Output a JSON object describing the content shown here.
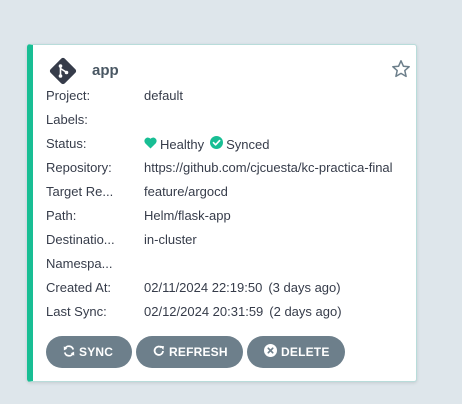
{
  "app": {
    "name": "app",
    "logo_icon": "git-icon",
    "favorite_icon": "star-outline-icon"
  },
  "fields": {
    "project": {
      "label": "Project:",
      "value": "default"
    },
    "labels": {
      "label": "Labels:",
      "value": ""
    },
    "status": {
      "label": "Status:",
      "health": "Healthy",
      "health_icon": "heart-icon",
      "health_color": "#18be94",
      "sync": "Synced",
      "sync_icon": "check-circle-icon",
      "sync_color": "#18be94"
    },
    "repository": {
      "label": "Repository:",
      "value": "https://github.com/cjcuesta/kc-practica-final"
    },
    "target_revision": {
      "label": "Target Re...",
      "value": "feature/argocd"
    },
    "path": {
      "label": "Path:",
      "value": "Helm/flask-app"
    },
    "destination": {
      "label": "Destinatio...",
      "value": "in-cluster"
    },
    "namespace": {
      "label": "Namespa...",
      "value": ""
    },
    "created_at": {
      "label": "Created At:",
      "value": "02/11/2024 22:19:50",
      "ago": "(3 days ago)"
    },
    "last_sync": {
      "label": "Last Sync:",
      "value": "02/12/2024 20:31:59",
      "ago": "(2 days ago)"
    }
  },
  "actions": {
    "sync": {
      "label": "SYNC",
      "icon": "sync-icon"
    },
    "refresh": {
      "label": "REFRESH",
      "icon": "refresh-icon"
    },
    "delete": {
      "label": "DELETE",
      "icon": "times-circle-icon"
    }
  },
  "colors": {
    "accent": "#18be94",
    "button_bg": "#6d7f8b",
    "page_bg": "#dee6eb"
  }
}
